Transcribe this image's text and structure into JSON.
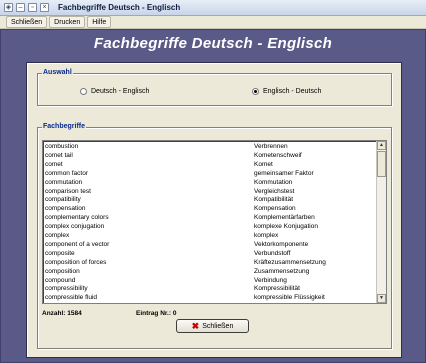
{
  "window": {
    "title": "Fachbegriffe Deutsch - Englisch",
    "icons": [
      "app-icon",
      "minimize-icon",
      "restore-icon",
      "close-icon"
    ]
  },
  "menu": {
    "items": [
      "Schließen",
      "Drucken",
      "Hilfe"
    ]
  },
  "header": {
    "title": "Fachbegriffe Deutsch - Englisch"
  },
  "auswahl": {
    "label": "Auswahl",
    "options": [
      "Deutsch - Englisch",
      "Englisch - Deutsch"
    ],
    "selected": 1
  },
  "terms": {
    "label": "Fachbegriffe",
    "rows": [
      {
        "en": "combustion",
        "de": "Verbrennen"
      },
      {
        "en": "comet tail",
        "de": "Kometenschweif"
      },
      {
        "en": "comet",
        "de": "Komet"
      },
      {
        "en": "common factor",
        "de": "gemeinsamer Faktor"
      },
      {
        "en": "commutation",
        "de": "Kommutation"
      },
      {
        "en": "comparison test",
        "de": "Vergleichstest"
      },
      {
        "en": "compatibility",
        "de": "Kompatibilität"
      },
      {
        "en": "compensation",
        "de": "Kompensation"
      },
      {
        "en": "complementary colors",
        "de": "Komplementärfarben"
      },
      {
        "en": "complex conjugation",
        "de": "komplexe Konjugation"
      },
      {
        "en": "complex",
        "de": "komplex"
      },
      {
        "en": "component of a vector",
        "de": "Vektorkomponente"
      },
      {
        "en": "composite",
        "de": "Verbundstoff"
      },
      {
        "en": "composition of forces",
        "de": "Kräftezusammensetzung"
      },
      {
        "en": "composition",
        "de": "Zusammensetzung"
      },
      {
        "en": "compound",
        "de": "Verbindung"
      },
      {
        "en": "compressibility",
        "de": "Kompressibilität"
      },
      {
        "en": "compressible fluid",
        "de": "kompressible Flüssigkeit"
      }
    ],
    "count_label": "Anzahl: 1584",
    "entry_label": "Eintrag Nr.: 0"
  },
  "close_button": {
    "label": "Schließen",
    "icon": "x-icon",
    "icon_color": "#cc0000"
  }
}
